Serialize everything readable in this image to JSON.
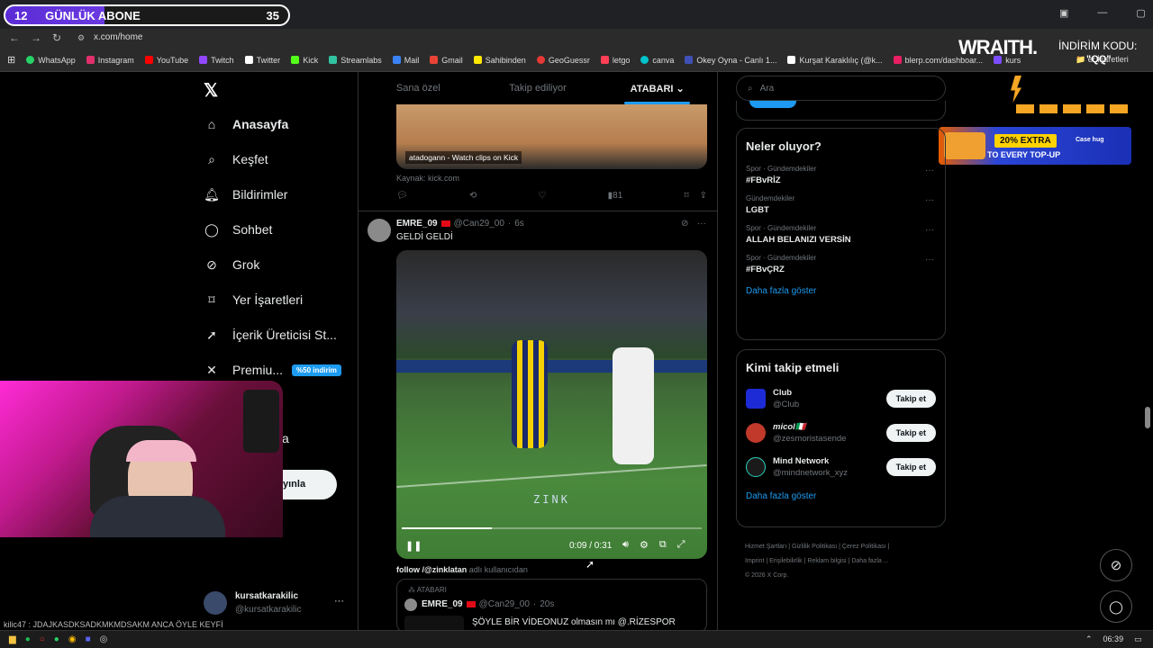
{
  "sub_counter": {
    "left": "12",
    "label": "GÜNLÜK ABONE",
    "right": "35"
  },
  "browser": {
    "url": "x.com/home",
    "bookmarks": [
      "WhatsApp",
      "Instagram",
      "YouTube",
      "Twitch",
      "Twitter",
      "Kick",
      "Streamlabs",
      "Mail",
      "Gmail",
      "Sahibinden",
      "GeoGuessr",
      "letgo",
      "canva",
      "Okey Oyna - Canlı 1...",
      "Kurşat Karaklılıç (@k...",
      "blerp.com/dashboar...",
      "kurs"
    ],
    "other_bookmarks": "er İşaretleri"
  },
  "overlay": {
    "brand": "WRAITH.",
    "code_label": "İNDİRİM KODU:",
    "code": "\"QQ\"",
    "promo_line1": "20% EXTRA",
    "promo_line2": "TO EVERY TOP-UP",
    "promo_brand": "Case hug"
  },
  "nav": {
    "items": [
      {
        "label": "Anasayfa"
      },
      {
        "label": "Keşfet"
      },
      {
        "label": "Bildirimler"
      },
      {
        "label": "Sohbet"
      },
      {
        "label": "Grok"
      },
      {
        "label": "Yer İşaretleri"
      },
      {
        "label": "İçerik Üreticisi St..."
      },
      {
        "label": "Premiu..."
      }
    ],
    "premium_badge": "%50 indirim",
    "more_partial": "a",
    "post_button_partial": "yınla",
    "profile": {
      "name": "kursatkarakilic",
      "handle": "@kursatkarakilic"
    }
  },
  "tabs": [
    "Sana özel",
    "Takip ediliyor",
    "ATABARI"
  ],
  "post1": {
    "watermark": "atadogann - Watch clips on Kick",
    "source": "Kaynak: kick.com",
    "views": "81"
  },
  "post2": {
    "name": "EMRE_09",
    "handle": "@Can29_00",
    "time": "6s",
    "text": "GELDİ GELDİ",
    "video_text": "ZINK",
    "video_time": "0:09 / 0:31",
    "progress": 0.3,
    "caption_bold": "follow /@zinklatan",
    "caption_rest": " adlı kullanıcıdan"
  },
  "quote": {
    "community": "ATABARI",
    "name": "EMRE_09",
    "handle": "@Can29_00",
    "time": "20s",
    "text": "ŞÖYLE BİR VİDEONUZ olmasın mı @.RİZESPOR"
  },
  "search_placeholder": "Ara",
  "trends": {
    "title": "Neler oluyor?",
    "items": [
      {
        "cat": "Spor · Gündemdekiler",
        "name": "#FBvRİZ"
      },
      {
        "cat": "Gündemdekiler",
        "name": "LGBT"
      },
      {
        "cat": "Spor · Gündemdekiler",
        "name": "ALLAH BELANIZI VERSİN"
      },
      {
        "cat": "Spor · Gündemdekiler",
        "name": "#FBvÇRZ"
      }
    ],
    "more": "Daha fazla göster"
  },
  "who_to_follow": {
    "title": "Kimi takip etmeli",
    "items": [
      {
        "name": "Club",
        "handle": "@Club",
        "color": "#1d2bd6"
      },
      {
        "name": "micol🇮🇹",
        "handle": "@zesmoristasende",
        "color": "#c0392b"
      },
      {
        "name": "Mind Network",
        "handle": "@mindnetwork_xyz",
        "color": "#1a1a1a"
      }
    ],
    "button": "Takip et",
    "more": "Daha fazla göster"
  },
  "footer": [
    "Hizmet Şartları",
    "Gizlilik Politikası",
    "Çerez Politikası",
    "Imprint",
    "Erişilebilirlik",
    "Reklam bilgisi",
    "Daha fazla ...",
    "© 2026 X Corp."
  ],
  "chat_line": "kilic47 : JDAJKASDKSADKMKMDSAKM ANCA ÖYLE KEYFİ",
  "taskbar": {
    "clock": "06:39"
  },
  "colors": {
    "accent": "#1d9bf0",
    "subcounter": "#5b2bd6"
  }
}
